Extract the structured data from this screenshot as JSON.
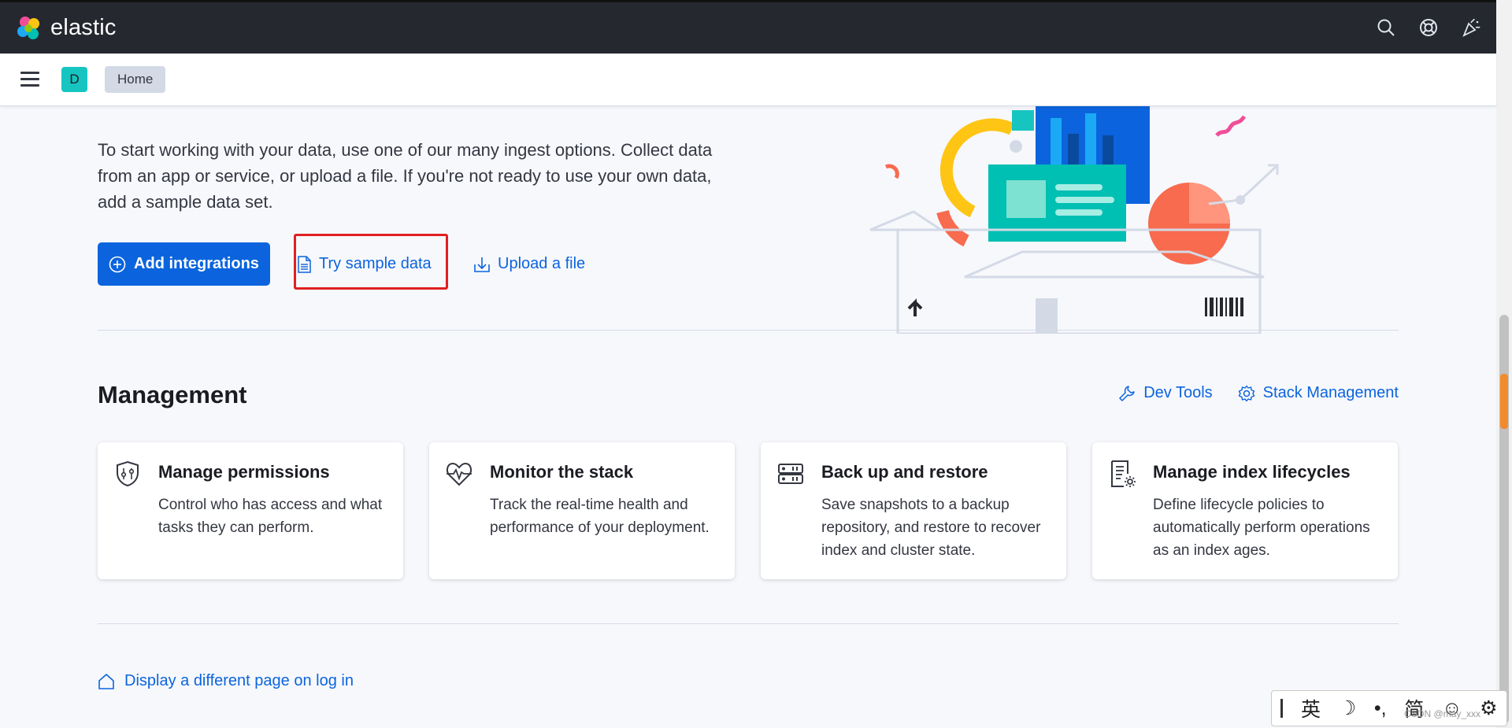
{
  "header": {
    "brand": "elastic"
  },
  "subheader": {
    "space_initial": "D",
    "breadcrumb": "Home"
  },
  "intro": {
    "text": "To start working with your data, use one of our many ingest options. Collect data from an app or service, or upload a file. If you're not ready to use your own data, add a sample data set.",
    "add_integrations": "Add integrations",
    "try_sample_data": "Try sample data",
    "upload_file": "Upload a file"
  },
  "management": {
    "title": "Management",
    "dev_tools": "Dev Tools",
    "stack_management": "Stack Management",
    "cards": [
      {
        "title": "Manage permissions",
        "text": "Control who has access and what tasks they can perform.",
        "icon": "shield-icon"
      },
      {
        "title": "Monitor the stack",
        "text": "Track the real-time health and performance of your deployment.",
        "icon": "heartbeat-icon"
      },
      {
        "title": "Back up and restore",
        "text": "Save snapshots to a backup repository, and restore to recover index and cluster state.",
        "icon": "storage-icon"
      },
      {
        "title": "Manage index lifecycles",
        "text": "Define lifecycle policies to automatically perform operations as an index ages.",
        "icon": "document-gear-icon"
      }
    ]
  },
  "footer": {
    "display_page_link": "Display a different page on log in"
  },
  "ime": {
    "lang": "英",
    "simplified": "简"
  },
  "watermark": "CSDN @may_xxx",
  "colors": {
    "accent": "#0b64dd",
    "header_bg": "#25282f",
    "highlight_box": "#e02020"
  }
}
